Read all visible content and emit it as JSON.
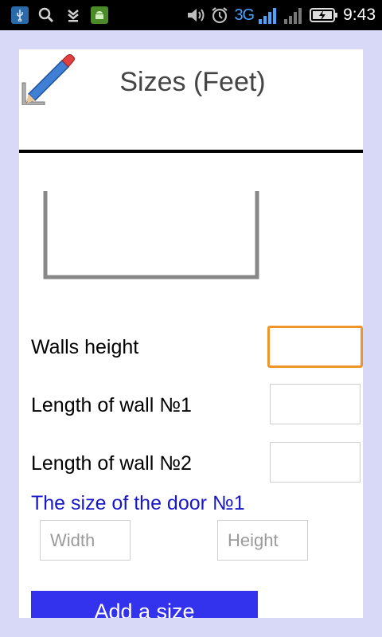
{
  "status_bar": {
    "network_type": "3G",
    "time": "9:43"
  },
  "header": {
    "title": "Sizes (Feet)"
  },
  "form": {
    "walls_height": {
      "label": "Walls height",
      "value": ""
    },
    "wall1_length": {
      "label": "Length of wall №1",
      "value": ""
    },
    "wall2_length": {
      "label": "Length of wall №2",
      "value": ""
    },
    "door1": {
      "title": "The size of the door №1",
      "width_placeholder": "Width",
      "height_placeholder": "Height"
    }
  },
  "actions": {
    "add_size_label": "Add a size"
  },
  "colors": {
    "background": "#d8d8f7",
    "accent_button": "#3333ee",
    "section_title": "#1818c8",
    "focus_border": "#f0952a"
  },
  "icons": [
    "usb-icon",
    "search-icon",
    "download-icon",
    "android-icon",
    "volume-icon",
    "alarm-icon",
    "signal-icon",
    "battery-icon",
    "pencil-ruler-icon"
  ]
}
